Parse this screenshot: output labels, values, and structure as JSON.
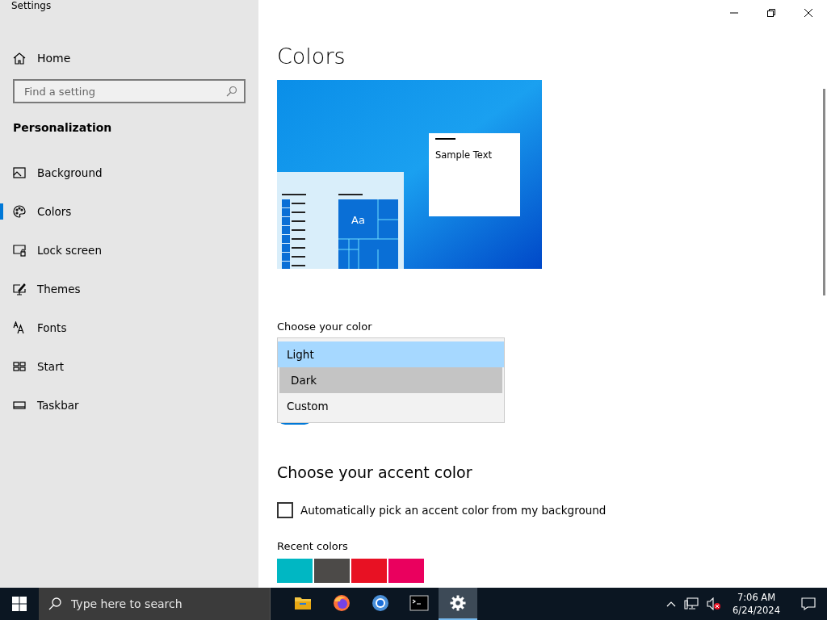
{
  "window": {
    "title": "Settings"
  },
  "sidebar": {
    "home": "Home",
    "search": {
      "placeholder": "Find a setting"
    },
    "section": "Personalization",
    "items": [
      {
        "label": "Background",
        "selected": false
      },
      {
        "label": "Colors",
        "selected": true
      },
      {
        "label": "Lock screen",
        "selected": false
      },
      {
        "label": "Themes",
        "selected": false
      },
      {
        "label": "Fonts",
        "selected": false
      },
      {
        "label": "Start",
        "selected": false
      },
      {
        "label": "Taskbar",
        "selected": false
      }
    ]
  },
  "main": {
    "title": "Colors",
    "preview": {
      "sample_text": "Sample Text",
      "tile_text": "Aa"
    },
    "choose_color": {
      "label": "Choose your color",
      "options": [
        {
          "label": "Light",
          "selected": true,
          "hovered": false
        },
        {
          "label": "Dark",
          "selected": false,
          "hovered": true
        },
        {
          "label": "Custom",
          "selected": false,
          "hovered": false
        }
      ]
    },
    "transparency": {
      "on": true
    },
    "accent_title": "Choose your accent color",
    "auto_pick": {
      "label": "Automatically pick an accent color from my background",
      "checked": false
    },
    "recent_label": "Recent colors",
    "recent_colors": [
      {
        "color": "#00b7c3"
      },
      {
        "color": "#4c4a48"
      },
      {
        "color": "#e81123"
      },
      {
        "color": "#ea005e"
      }
    ]
  },
  "taskbar": {
    "search": {
      "placeholder": "Type here to search"
    },
    "apps": [
      {
        "kind": "files",
        "active": false
      },
      {
        "kind": "firefox",
        "active": false
      },
      {
        "kind": "chrome",
        "active": false
      },
      {
        "kind": "terminal",
        "active": false
      },
      {
        "kind": "settings",
        "active": true
      }
    ],
    "time": "7:06 AM",
    "date": "6/24/2024"
  }
}
